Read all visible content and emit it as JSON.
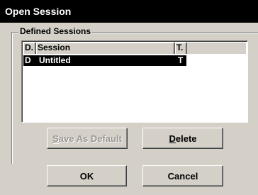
{
  "window": {
    "title": "Open Session"
  },
  "group": {
    "label": "Defined Sessions"
  },
  "list": {
    "columns": [
      {
        "label": "D."
      },
      {
        "label": "Session"
      },
      {
        "label": "T."
      }
    ],
    "rows": [
      {
        "d": "D",
        "session": "Untitled",
        "t": "T",
        "selected": true
      }
    ]
  },
  "buttons": {
    "save_default": {
      "mnemonic": "S",
      "rest": "ave As Default",
      "enabled": false
    },
    "delete": {
      "mnemonic": "D",
      "rest": "elete",
      "enabled": true
    },
    "ok": {
      "label": "OK"
    },
    "cancel": {
      "label": "Cancel"
    }
  },
  "colors": {
    "face": "#d4d0c8",
    "selection": "#000000",
    "titlebar": "#000000"
  }
}
